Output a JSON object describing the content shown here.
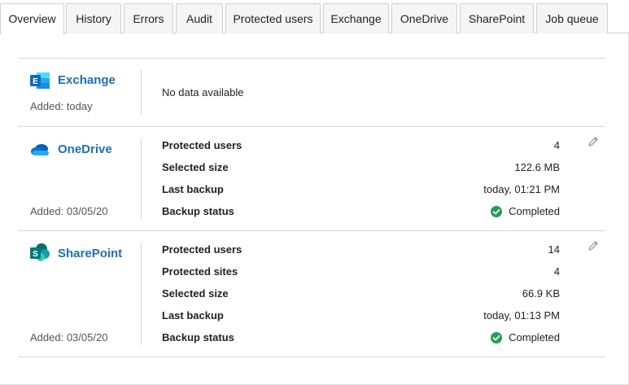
{
  "tabs": [
    {
      "label": "Overview",
      "active": true
    },
    {
      "label": "History"
    },
    {
      "label": "Errors"
    },
    {
      "label": "Audit"
    },
    {
      "label": "Protected users"
    },
    {
      "label": "Exchange"
    },
    {
      "label": "OneDrive"
    },
    {
      "label": "SharePoint"
    },
    {
      "label": "Job queue"
    }
  ],
  "exchange": {
    "name": "Exchange",
    "icon": "exchange-icon",
    "added": "Added: today",
    "message": "No data available"
  },
  "onedrive": {
    "name": "OneDrive",
    "icon": "onedrive-icon",
    "added": "Added: 03/05/20",
    "rows": [
      {
        "label": "Protected users",
        "value": "4"
      },
      {
        "label": "Selected size",
        "value": "122.6 MB"
      },
      {
        "label": "Last backup",
        "value": "today, 01:21 PM"
      },
      {
        "label": "Backup status",
        "value": "Completed"
      }
    ]
  },
  "sharepoint": {
    "name": "SharePoint",
    "icon": "sharepoint-icon",
    "added": "Added: 03/05/20",
    "rows": [
      {
        "label": "Protected users",
        "value": "14"
      },
      {
        "label": "Protected sites",
        "value": "4"
      },
      {
        "label": "Selected size",
        "value": "66.9 KB"
      },
      {
        "label": "Last backup",
        "value": "today, 01:13 PM"
      },
      {
        "label": "Backup status",
        "value": "Completed"
      }
    ]
  },
  "colors": {
    "link": "#1f6db5",
    "success": "#1f9d57",
    "exchange": "#0f6cbd",
    "onedrive": "#0f78d4",
    "sharepoint": "#038387"
  }
}
